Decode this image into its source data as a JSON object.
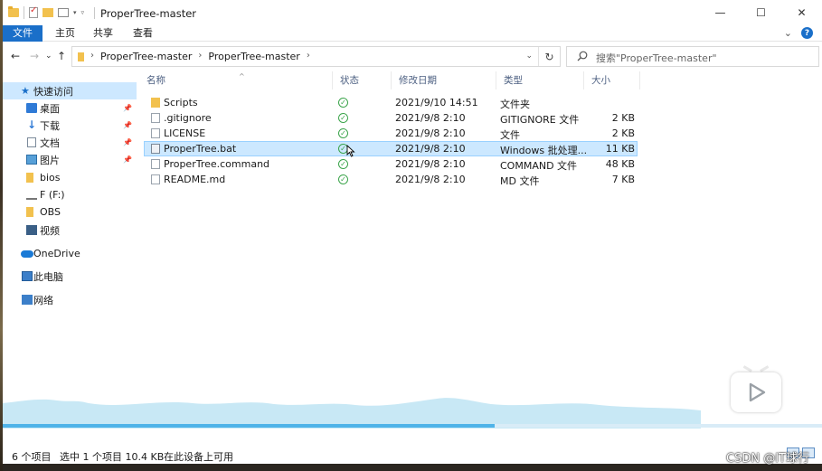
{
  "window": {
    "title": "ProperTree-master",
    "controls": {
      "minimize": "—",
      "maximize": "☐",
      "close": "✕"
    }
  },
  "ribbon": {
    "tabs": [
      "文件",
      "主页",
      "共享",
      "查看"
    ],
    "expand": "⌄",
    "help": "?"
  },
  "nav": {
    "back": "←",
    "forward": "→",
    "recent": "⌄",
    "up": "↑",
    "breadcrumbs": [
      "ProperTree-master",
      "ProperTree-master"
    ],
    "refresh": "↻"
  },
  "search": {
    "placeholder": "搜索\"ProperTree-master\""
  },
  "sidebar": {
    "items": [
      {
        "label": "快速访问",
        "icon": "star-icon"
      },
      {
        "label": "桌面",
        "icon": "desktop-icon",
        "pinned": true
      },
      {
        "label": "下载",
        "icon": "download-icon",
        "pinned": true
      },
      {
        "label": "文档",
        "icon": "document-icon",
        "pinned": true
      },
      {
        "label": "图片",
        "icon": "pictures-icon",
        "pinned": true
      },
      {
        "label": "bios",
        "icon": "folder-icon"
      },
      {
        "label": "F (F:)",
        "icon": "drive-icon"
      },
      {
        "label": "OBS",
        "icon": "folder-icon"
      },
      {
        "label": "视频",
        "icon": "video-icon"
      },
      {
        "label": "OneDrive",
        "icon": "onedrive-icon"
      },
      {
        "label": "此电脑",
        "icon": "computer-icon"
      },
      {
        "label": "网络",
        "icon": "network-icon"
      }
    ]
  },
  "columns": [
    "名称",
    "状态",
    "修改日期",
    "类型",
    "大小"
  ],
  "files": [
    {
      "name": "Scripts",
      "date": "2021/9/10 14:51",
      "type": "文件夹",
      "size": "",
      "kind": "folder"
    },
    {
      "name": ".gitignore",
      "date": "2021/9/8 2:10",
      "type": "GITIGNORE 文件",
      "size": "2 KB",
      "kind": "doc"
    },
    {
      "name": "LICENSE",
      "date": "2021/9/8 2:10",
      "type": "文件",
      "size": "2 KB",
      "kind": "doc"
    },
    {
      "name": "ProperTree.bat",
      "date": "2021/9/8 2:10",
      "type": "Windows 批处理...",
      "size": "11 KB",
      "kind": "bat",
      "selected": true
    },
    {
      "name": "ProperTree.command",
      "date": "2021/9/8 2:10",
      "type": "COMMAND 文件",
      "size": "48 KB",
      "kind": "doc"
    },
    {
      "name": "README.md",
      "date": "2021/9/8 2:10",
      "type": "MD 文件",
      "size": "7 KB",
      "kind": "doc"
    }
  ],
  "status": {
    "item_count": "6 个项目",
    "selection": "选中 1 个项目  10.4 KB",
    "availability": "在此设备上可用"
  },
  "video": {
    "progress": 0.6
  },
  "watermark": "CSDN @IT球行",
  "colors": {
    "accent": "#1a6fc9",
    "selection": "#cce8ff",
    "status_ok": "#3aa44a"
  }
}
